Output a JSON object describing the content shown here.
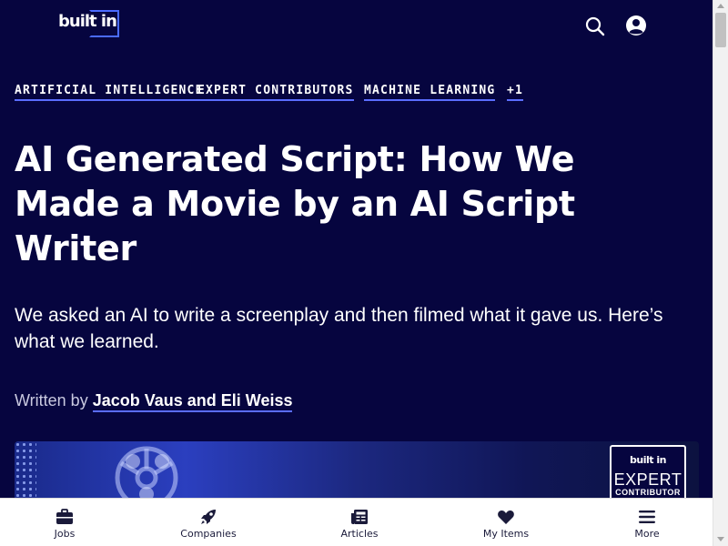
{
  "header": {
    "logo_text": "built in",
    "search_icon": "search-icon",
    "account_icon": "account-circle-icon"
  },
  "tags": [
    {
      "label": "ARTIFICIAL INTELLIGENCE"
    },
    {
      "label": "EXPERT CONTRIBUTORS"
    },
    {
      "label": "MACHINE LEARNING"
    },
    {
      "label": "+1"
    }
  ],
  "article": {
    "title": "AI Generated Script: How We Made a Movie by an AI Script Writer",
    "subtitle": "We asked an AI to write a screenplay and then filmed what it gave us. Here’s what we learned.",
    "byline_prefix": "Written by",
    "authors": "Jacob Vaus and Eli Weiss"
  },
  "badge": {
    "logo": "built in",
    "title": "EXPERT",
    "subtitle": "CONTRIBUTOR"
  },
  "bottom_nav": [
    {
      "label": "Jobs",
      "icon": "briefcase-icon"
    },
    {
      "label": "Companies",
      "icon": "rocket-icon"
    },
    {
      "label": "Articles",
      "icon": "newspaper-icon"
    },
    {
      "label": "My Items",
      "icon": "heart-icon"
    },
    {
      "label": "More",
      "icon": "menu-icon"
    }
  ],
  "colors": {
    "background": "#06053f",
    "accent_underline": "#5a6dff",
    "nav_background": "#ffffff"
  }
}
